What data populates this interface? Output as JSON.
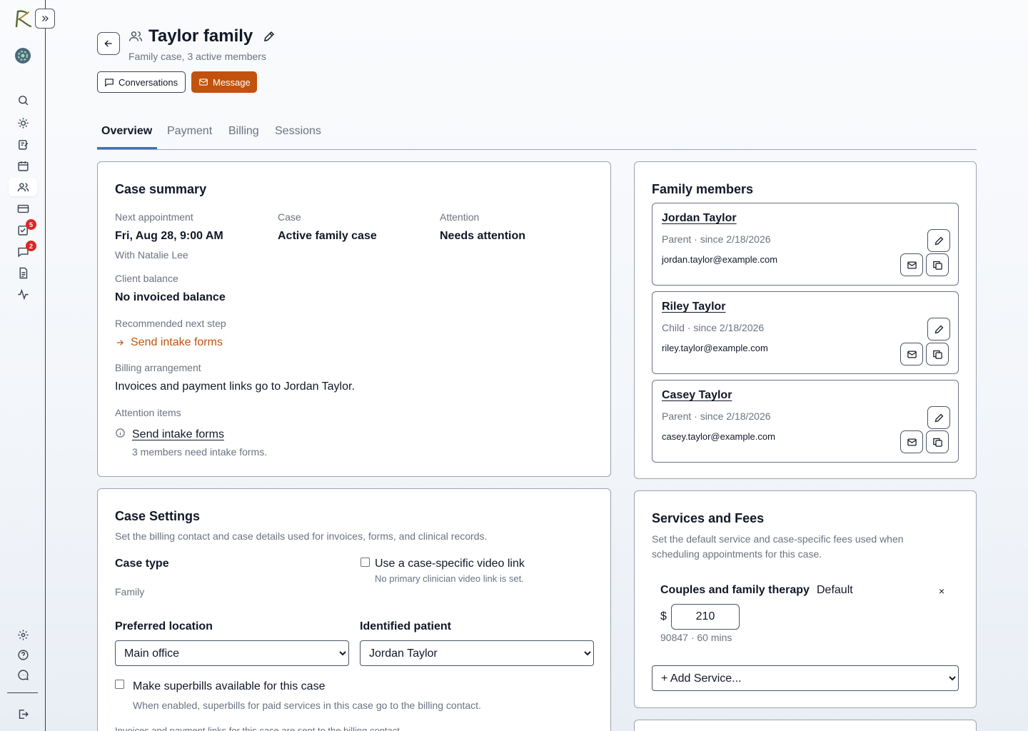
{
  "colors": {
    "accent": "#c2520c",
    "tab_indicator": "#3f6fb6",
    "badge": "#dc2626"
  },
  "sidebar": {
    "icons": [
      "search-icon",
      "sun-icon",
      "edit-note-icon",
      "calendar-icon",
      "users-icon",
      "card-icon",
      "task-icon",
      "chat-icon",
      "document-icon",
      "activity-icon",
      "gear-icon",
      "help-icon",
      "feedback-icon",
      "logout-icon"
    ],
    "tasks_badge": "5",
    "messages_badge": "2"
  },
  "header": {
    "title": "Taylor family",
    "subtitle": "Family case, 3 active members",
    "conversations_label": "Conversations",
    "message_label": "Message"
  },
  "tabs": [
    "Overview",
    "Payment",
    "Billing",
    "Sessions"
  ],
  "case_summary": {
    "title": "Case summary",
    "next_appointment_label": "Next appointment",
    "next_appointment_value": "Fri, Aug 28, 9:00 AM",
    "next_appointment_with": "With Natalie Lee",
    "case_label": "Case",
    "case_value": "Active family case",
    "attention_label": "Attention",
    "attention_value": "Needs attention",
    "balance_label": "Client balance",
    "balance_value": "No invoiced balance",
    "next_step_label": "Recommended next step",
    "next_step_link": "Send intake forms",
    "billing_label": "Billing arrangement",
    "billing_value": "Invoices and payment links go to Jordan Taylor.",
    "attention_items_label": "Attention items",
    "attention_item_link": "Send intake forms",
    "attention_item_detail": "3 members need intake forms."
  },
  "family": {
    "title": "Family members",
    "members": [
      {
        "name": "Jordan Taylor",
        "role": "Parent · since 2/18/2026",
        "email": "jordan.taylor@example.com"
      },
      {
        "name": "Riley Taylor",
        "role": "Child · since 2/18/2026",
        "email": "riley.taylor@example.com"
      },
      {
        "name": "Casey Taylor",
        "role": "Parent · since 2/18/2026",
        "email": "casey.taylor@example.com"
      }
    ]
  },
  "settings": {
    "title": "Case Settings",
    "description": "Set the billing contact and case details used for invoices, forms, and clinical records.",
    "case_type_label": "Case type",
    "case_type_value": "Family",
    "video_link_label": "Use a case-specific video link",
    "video_link_note": "No primary clinician video link is set.",
    "location_label": "Preferred location",
    "location_value": "Main office",
    "patient_label": "Identified patient",
    "patient_value": "Jordan Taylor",
    "superbills_label": "Make superbills available for this case",
    "superbills_note": "When enabled, superbills for paid services in this case go to the billing contact.",
    "footer_note": "Invoices and payment links for this case are sent to the billing contact."
  },
  "services": {
    "title": "Services and Fees",
    "description_line1": "Set the default service and case-specific fees used when",
    "description_line2": "scheduling appointments for this case.",
    "service_name": "Couples and family therapy",
    "service_default": "Default",
    "remove_glyph": "×",
    "currency": "$",
    "fee": "210",
    "code_duration": "90847 · 60 mins",
    "add_service": "+ Add Service..."
  }
}
